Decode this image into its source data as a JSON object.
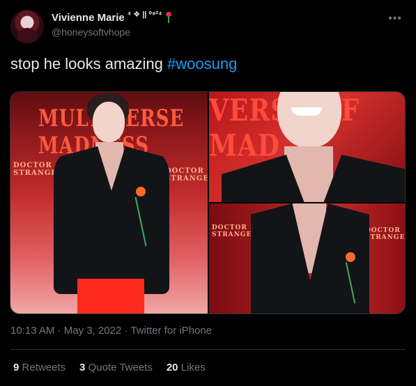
{
  "author": {
    "display_name": "Vivienne Marie",
    "display_extra": "⁴ ❖ || ⁰⁸²⁴",
    "handle": "@honeysoftvhope",
    "emoji": "rose-icon"
  },
  "tweet": {
    "text": "stop he looks amazing ",
    "hashtag": "#woosung"
  },
  "media": {
    "photos": [
      {
        "banner_top": "MULTIVERSE MADNESS",
        "banner_side": "DOCTOR STRANGE"
      },
      {
        "banner_top": "VERSE OF MAD"
      },
      {
        "banner_side": "DOCTOR STRANGE"
      }
    ]
  },
  "meta": {
    "time": "10:13 AM",
    "date": "May 3, 2022",
    "source": "Twitter for iPhone",
    "separator": " · "
  },
  "stats": {
    "retweets_count": "9",
    "retweets_label": "Retweets",
    "quotes_count": "3",
    "quotes_label": "Quote Tweets",
    "likes_count": "20",
    "likes_label": "Likes"
  },
  "colors": {
    "background": "#000000",
    "text": "#e7e9ea",
    "muted": "#71767b",
    "link": "#1d9bf0",
    "divider": "#2f3336"
  }
}
